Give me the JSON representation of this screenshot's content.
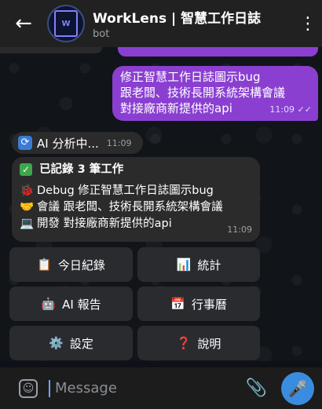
{
  "header": {
    "title": "WorkLens | 智慧工作日誌",
    "subtitle": "bot",
    "avatar_text": "WORKLENS AI",
    "menu_icon": "more-vertical-icon"
  },
  "messages": {
    "outgoing": {
      "lines": [
        "修正智慧工作日誌圖示bug",
        "跟老闆、技術長開系統架構會議",
        "對接廠商新提供的api"
      ],
      "time": "11:09",
      "status": "✓✓"
    },
    "ai_status": {
      "text": "AI 分析中...",
      "time": "11:09"
    },
    "summary": {
      "title": "已記錄 3 筆工作",
      "items": [
        {
          "emoji": "🐞",
          "text": "Debug 修正智慧工作日誌圖示bug"
        },
        {
          "emoji": "🤝",
          "text": "會議 跟老闆、技術長開系統架構會議"
        },
        {
          "emoji": "💻",
          "text": "開發 對接廠商新提供的api"
        }
      ],
      "time": "11:09"
    }
  },
  "keyboard": [
    {
      "icon": "📋",
      "label": "今日紀錄"
    },
    {
      "icon": "📊",
      "label": "統計"
    },
    {
      "icon": "🤖",
      "label": "AI 報告"
    },
    {
      "icon": "📅",
      "label": "行事曆"
    },
    {
      "icon": "⚙️",
      "label": "設定"
    },
    {
      "icon": "❓",
      "label": "說明"
    }
  ],
  "input": {
    "placeholder": "Message"
  },
  "colors": {
    "accent": "#8a3fd1",
    "mic": "#3a8dde"
  }
}
